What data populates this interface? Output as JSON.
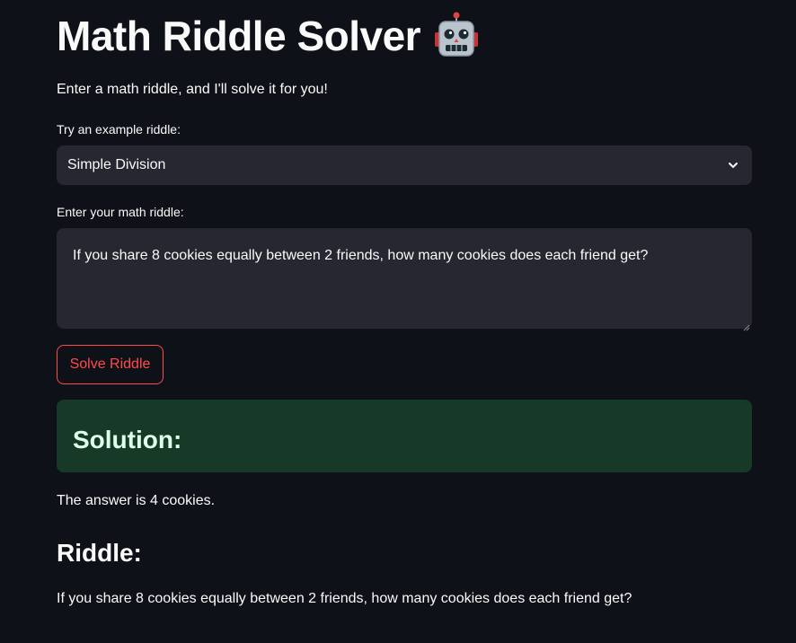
{
  "header": {
    "title": "Math Riddle Solver",
    "title_icon": "robot-face-icon"
  },
  "intro_text": "Enter a math riddle, and I'll solve it for you!",
  "example_select": {
    "label": "Try an example riddle:",
    "selected": "Simple Division",
    "icon": "chevron-down-icon"
  },
  "riddle_input": {
    "label": "Enter your math riddle:",
    "value": "If you share 8 cookies equally between 2 friends, how many cookies does each friend get?"
  },
  "solve_button": {
    "label": "Solve Riddle",
    "color": "#ff4b4b"
  },
  "solution": {
    "heading": "Solution:",
    "answer": "The answer is 4 cookies.",
    "box_color": "#173928"
  },
  "riddle_section": {
    "heading": "Riddle:",
    "text": "If you share 8 cookies equally between 2 friends, how many cookies does each friend get?"
  },
  "colors": {
    "background": "#0e1117",
    "input_background": "#262730",
    "text": "#fafafa"
  }
}
